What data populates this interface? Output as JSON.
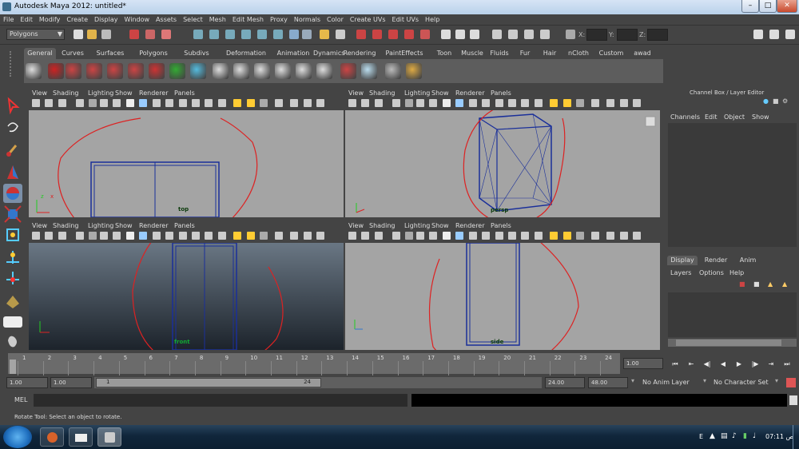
{
  "window": {
    "title": "Autodesk Maya 2012: untitled*"
  },
  "menu": [
    "File",
    "Edit",
    "Modify",
    "Create",
    "Display",
    "Window",
    "Assets",
    "Select",
    "Mesh",
    "Edit Mesh",
    "Proxy",
    "Normals",
    "Color",
    "Create UVs",
    "Edit UVs",
    "Help"
  ],
  "status_line": {
    "mode": "Polygons",
    "x_label": "X:",
    "y_label": "Y:",
    "z_label": "Z:"
  },
  "shelf_tabs": [
    "General",
    "Curves",
    "Surfaces",
    "Polygons",
    "Subdivs",
    "Deformation",
    "Animation",
    "Dynamics",
    "Rendering",
    "PaintEffects",
    "Toon",
    "Muscle",
    "Fluids",
    "Fur",
    "Hair",
    "nCloth",
    "Custom",
    "awad"
  ],
  "panel_menu": [
    "View",
    "Shading",
    "Lighting",
    "Show",
    "Renderer",
    "Panels"
  ],
  "viewports": {
    "top": "top",
    "persp": "persp",
    "front": "front",
    "side": "side"
  },
  "channel_box": {
    "title": "Channel Box / Layer Editor",
    "menu": [
      "Channels",
      "Edit",
      "Object",
      "Show"
    ]
  },
  "layer_editor": {
    "tabs": [
      "Display",
      "Render",
      "Anim"
    ],
    "menu": [
      "Layers",
      "Options",
      "Help"
    ]
  },
  "time_slider": {
    "ticks": [
      "1",
      "2",
      "3",
      "4",
      "5",
      "6",
      "7",
      "8",
      "9",
      "10",
      "11",
      "12",
      "13",
      "14",
      "15",
      "16",
      "17",
      "18",
      "19",
      "20",
      "21",
      "22",
      "23",
      "24"
    ],
    "current_frame": "1.00"
  },
  "range": {
    "start": "1.00",
    "start2": "1.00",
    "range_start": "1",
    "range_end": "24",
    "end": "24.00",
    "end2": "48.00",
    "anim_layer": "No Anim Layer",
    "char_set": "No Character Set"
  },
  "command_line": {
    "label": "MEL"
  },
  "help_line": "Rotate Tool: Select an object to rotate.",
  "taskbar": {
    "clock": "07:11 ص",
    "lang": "E"
  }
}
